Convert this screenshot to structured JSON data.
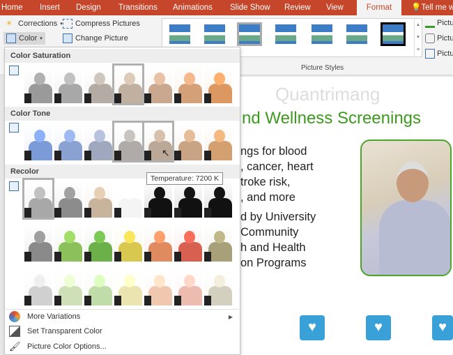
{
  "tabs": [
    "Home",
    "Insert",
    "Design",
    "Transitions",
    "Animations",
    "Slide Show",
    "Review",
    "View",
    "Format",
    "Tell me w"
  ],
  "active_tab": "Format",
  "ribbon": {
    "corrections": "Corrections",
    "color": "Color",
    "compress": "Compress Pictures",
    "change": "Change Picture",
    "picture_styles_label": "Picture Styles",
    "right_items": [
      "Pictu",
      "Pictu",
      "Pictu"
    ]
  },
  "menu": {
    "sections": {
      "saturation": "Color Saturation",
      "tone": "Color Tone",
      "recolor": "Recolor"
    },
    "saturation_tints": [
      "#9a9a9a",
      "#a8a8a8",
      "#b4aca4",
      "#c0b0a0",
      "#caa890",
      "#d4a078",
      "#dc9860"
    ],
    "tone_tints": [
      "#7a9ad8",
      "#8aa2d2",
      "#a0a8c0",
      "#b0aaa8",
      "#bca896",
      "#c8a484",
      "#d4a070"
    ],
    "recolor_tints": [
      [
        "#a8a8a8",
        "#8c8c8c",
        "#c8b49c",
        "#f4f4f4",
        "#111111",
        "#111111",
        "#111111"
      ],
      [
        "#8a8a8a",
        "#8cc05a",
        "#6cb04a",
        "#d8c850",
        "#e08a60",
        "#d86050",
        "#a8a078"
      ],
      [
        "#d0d0d0",
        "#cfe0b8",
        "#c0dca8",
        "#ece4b0",
        "#f0c8b0",
        "#ecbcb0",
        "#d4d0c0"
      ]
    ],
    "items": [
      "More Variations",
      "Set Transparent Color",
      "Picture Color Options..."
    ]
  },
  "tooltip": "Temperature: 7200 K",
  "slide": {
    "watermark": "Quantrimang",
    "title": "nd Wellness Screenings",
    "bullets": [
      "ngs for blood",
      ", cancer, heart",
      "troke risk,",
      ", and more",
      "d by University",
      " Community",
      "h and Health",
      "on Programs"
    ]
  },
  "colors": {
    "accent": "#c5462a",
    "title_green": "#3d9a1f",
    "icon_blue": "#3aa0d8"
  }
}
